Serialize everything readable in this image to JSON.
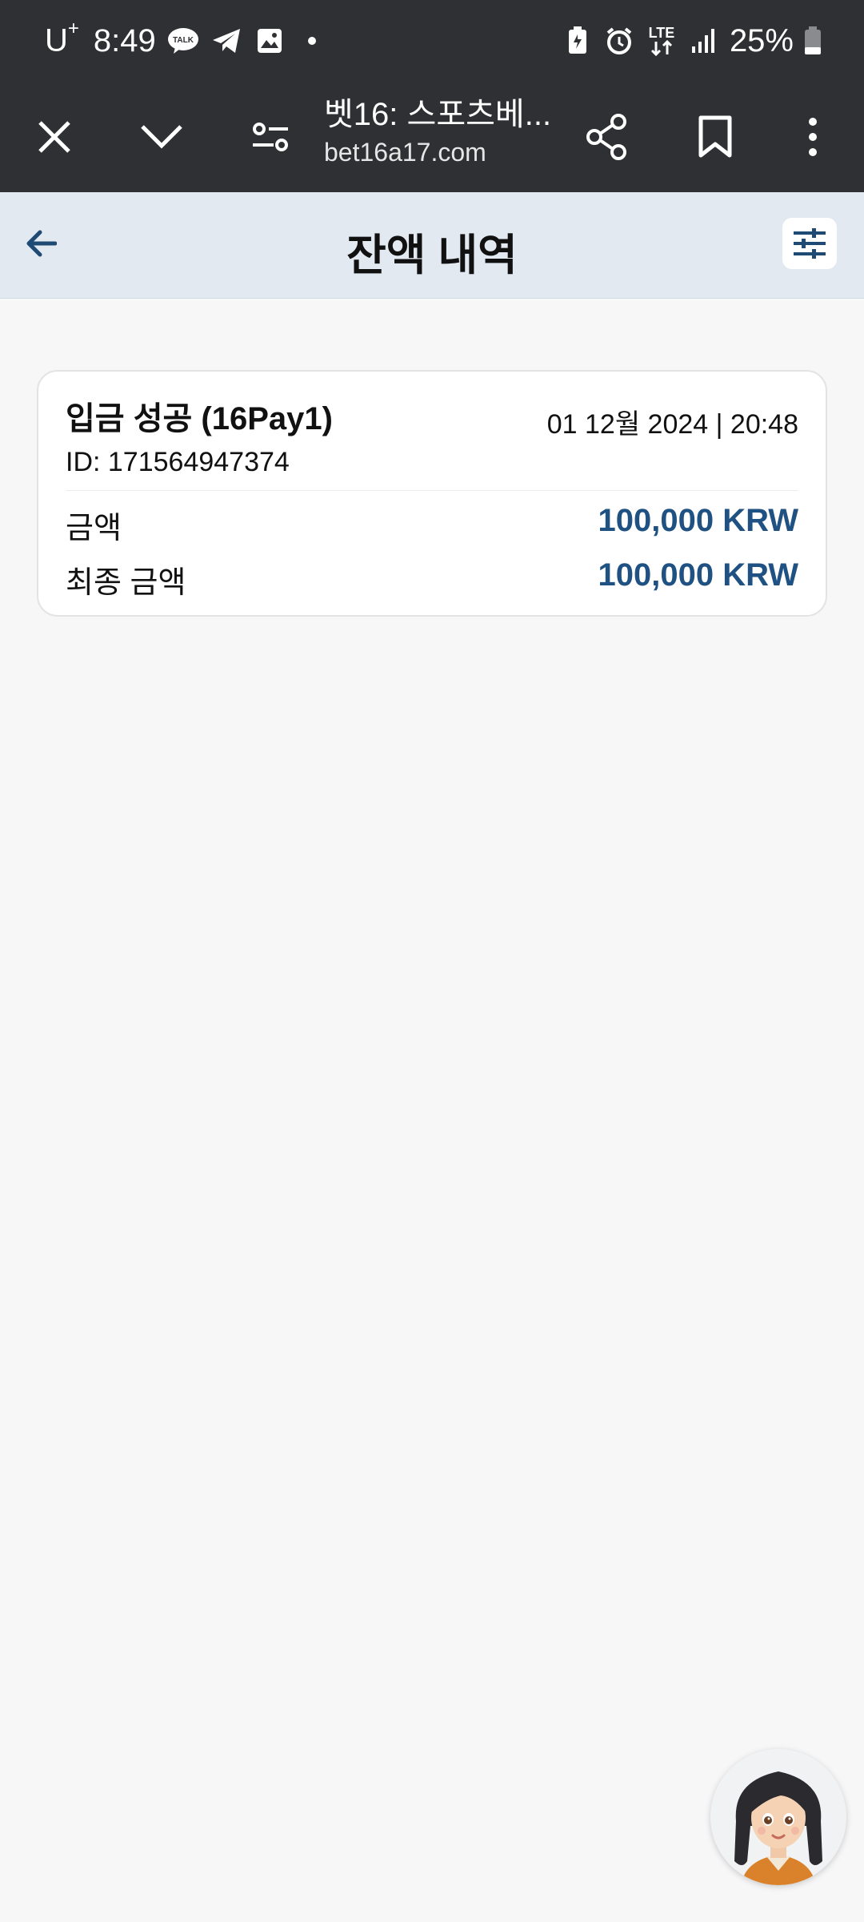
{
  "status_bar": {
    "carrier": "U",
    "carrier_sup": "+",
    "time": "8:49",
    "network": "LTE",
    "battery": "25%"
  },
  "browser": {
    "title": "벳16: 스포츠베...",
    "url": "bet16a17.com"
  },
  "header": {
    "title": "잔액 내역"
  },
  "transaction": {
    "title": "입금 성공 (16Pay1)",
    "date": "01 12월 2024 | 20:48",
    "id": "ID: 171564947374",
    "amount_label": "금액",
    "amount_value": "100,000 KRW",
    "final_label": "최종 금액",
    "final_value": "100,000 KRW"
  },
  "colors": {
    "accent": "#1f5282",
    "header_bg": "#e2e9f1",
    "browser_bg": "#2f3033"
  }
}
